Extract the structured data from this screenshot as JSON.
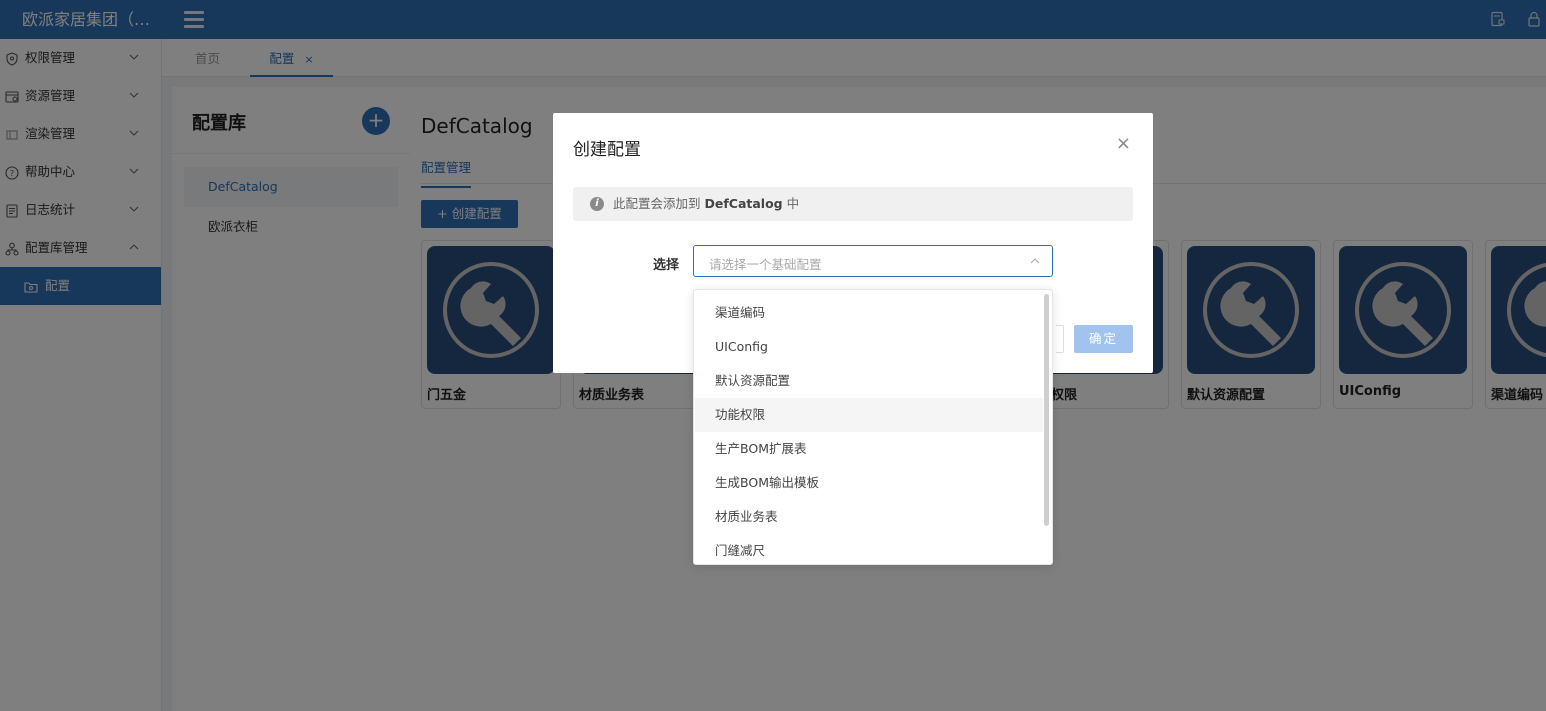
{
  "app": {
    "brand": "欧派家居集团（大..."
  },
  "topbar": {
    "icons": [
      "document-lock-icon",
      "lock-icon"
    ]
  },
  "sidebar": {
    "items": [
      {
        "label": "权限管理",
        "icon": "shield-icon",
        "expanded": false
      },
      {
        "label": "资源管理",
        "icon": "resource-icon",
        "expanded": false
      },
      {
        "label": "渲染管理",
        "icon": "render-icon",
        "expanded": false
      },
      {
        "label": "帮助中心",
        "icon": "help-icon",
        "expanded": false
      },
      {
        "label": "日志统计",
        "icon": "log-icon",
        "expanded": false
      },
      {
        "label": "配置库管理",
        "icon": "org-tree-icon",
        "expanded": true
      },
      {
        "label": "配置",
        "icon": "folder-icon",
        "active": true
      }
    ]
  },
  "tabs": {
    "home": "首页",
    "config": "配置",
    "close": "×"
  },
  "catalog": {
    "title": "配置库",
    "add": "+",
    "items": [
      {
        "label": "DefCatalog",
        "active": true
      },
      {
        "label": "欧派衣柜",
        "active": false
      }
    ]
  },
  "main": {
    "title": "DefCatalog",
    "tab": "配置管理",
    "create_button": "+ 创建配置",
    "cards": [
      "门五金",
      "材质业务表",
      "",
      "",
      "功能权限",
      "默认资源配置",
      "UIConfig",
      "渠道编码"
    ]
  },
  "modal": {
    "title": "创建配置",
    "close": "×",
    "alert_prefix": "此配置会添加到 ",
    "alert_catalog": "DefCatalog",
    "alert_suffix": " 中",
    "field_label": "选择",
    "select_placeholder": "请选择一个基础配置",
    "ok_button": "确定"
  },
  "dropdown": {
    "options": [
      "渠道编码",
      "UIConfig",
      "默认资源配置",
      "功能权限",
      "生产BOM扩展表",
      "生成BOM输出模板",
      "材质业务表",
      "门缝减尺"
    ],
    "hover_index": 3
  },
  "colors": {
    "primary": "#2f6fb7",
    "card_thumb": "#2b4f7e",
    "ok_disabled": "#a0c4ee"
  }
}
